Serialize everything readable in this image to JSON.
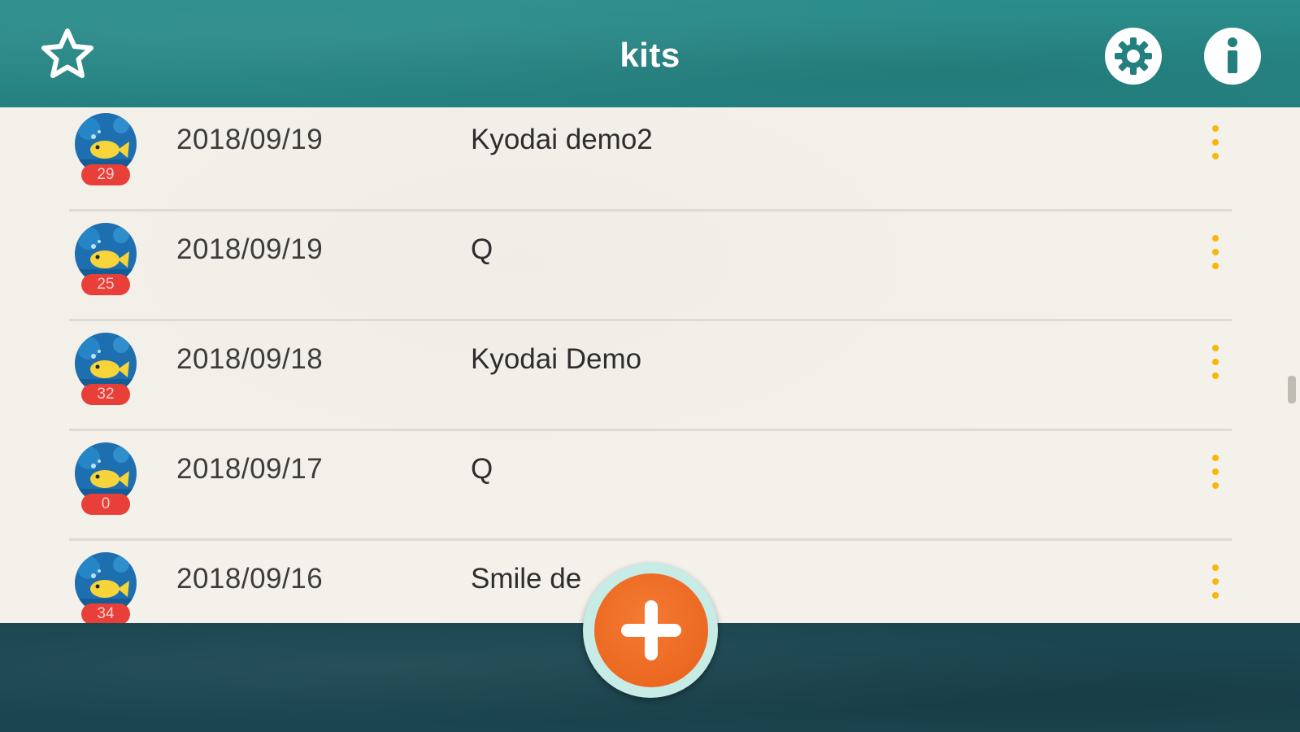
{
  "header": {
    "title": "kits",
    "left_icon": "star-outline-icon",
    "right_icons": [
      "gear-icon",
      "info-icon"
    ]
  },
  "kits": [
    {
      "date": "2018/09/19",
      "name": "Kyodai demo2",
      "count": "29"
    },
    {
      "date": "2018/09/19",
      "name": "Q",
      "count": "25"
    },
    {
      "date": "2018/09/18",
      "name": "Kyodai Demo",
      "count": "32"
    },
    {
      "date": "2018/09/17",
      "name": "Q",
      "count": "0"
    },
    {
      "date": "2018/09/16",
      "name": "Smile de",
      "count": "34"
    }
  ],
  "fab": {
    "icon": "plus-icon",
    "color": "#e8611a"
  },
  "colors": {
    "header": "#23807f",
    "sheet": "#f4f1ea",
    "badge": "#e84039",
    "menu_dots": "#f7b60d",
    "bottom": "#1b4650"
  }
}
